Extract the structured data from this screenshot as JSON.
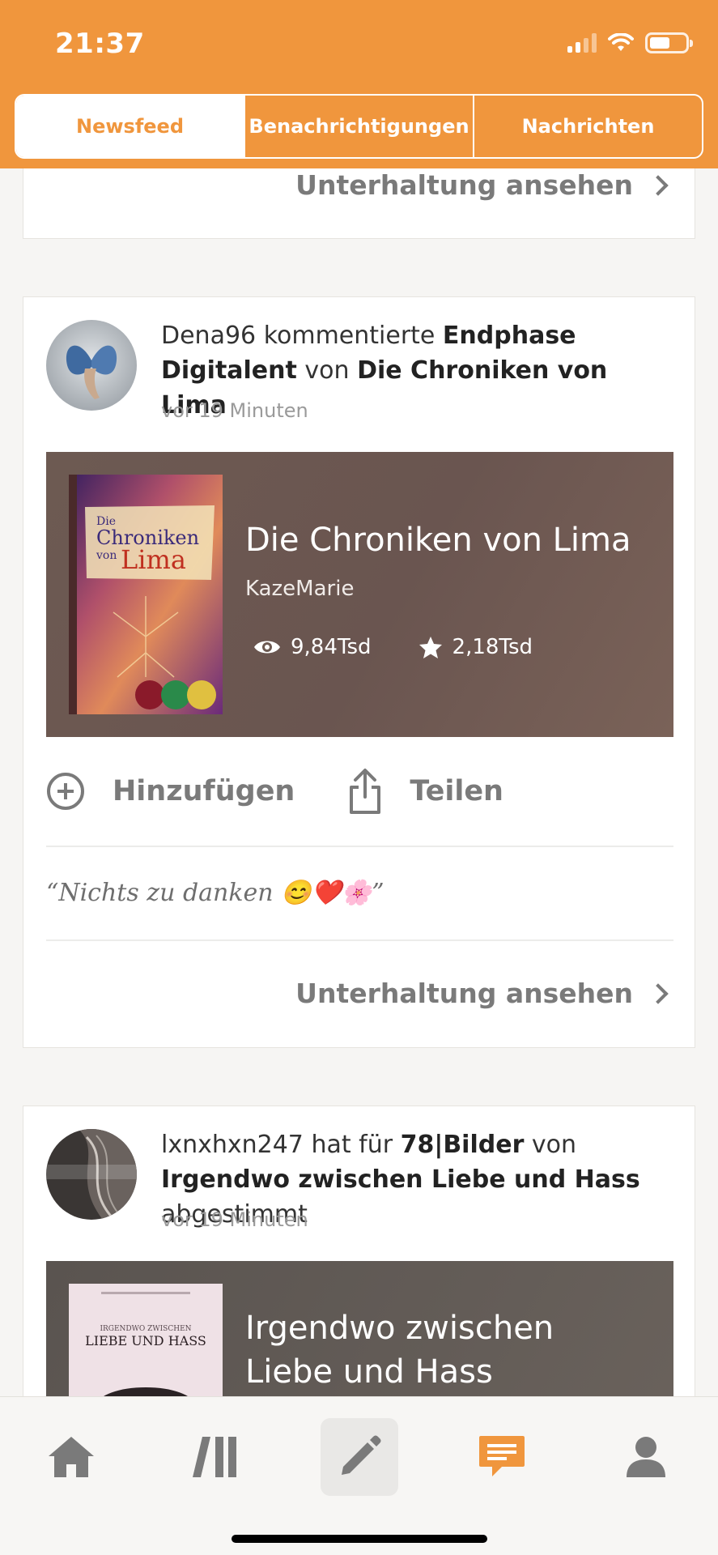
{
  "status_bar": {
    "time": "21:37"
  },
  "tabs": [
    {
      "label": "Newsfeed",
      "active": true
    },
    {
      "label": "Benachrichtigungen",
      "active": false
    },
    {
      "label": "Nachrichten",
      "active": false
    }
  ],
  "prev_card": {
    "link": "Unterhaltung ansehen"
  },
  "card1": {
    "user": "Dena96",
    "verb": "kommentierte",
    "target": "Endphase Digitalent",
    "von": "von",
    "story_ref": "Die Chroniken von Lima",
    "time": "vor 19 Minuten",
    "story": {
      "title": "Die Chroniken von Lima",
      "author": "KazeMarie",
      "views": "9,84Tsd",
      "votes": "2,18Tsd",
      "cover_text": [
        "Die",
        "Chroniken",
        "von",
        "Lima"
      ]
    },
    "add_label": "Hinzufügen",
    "share_label": "Teilen",
    "quote": "“Nichts zu danken 😊❤️🌸”",
    "link": "Unterhaltung ansehen"
  },
  "card2": {
    "user": "lxnxhxn247",
    "verb": "hat für",
    "target": "78|Bilder",
    "von": "von",
    "story_ref": "Irgendwo zwischen Liebe und Hass",
    "action": "abgestimmt",
    "time": "vor 19 Minuten",
    "story": {
      "title": "Irgendwo zwischen Liebe und Hass",
      "cover_text": [
        "IRGENDWO ZWISCHEN",
        "LIEBE UND HASS"
      ]
    }
  },
  "bottom_nav": [
    "home-icon",
    "library-icon",
    "write-icon",
    "messages-icon",
    "profile-icon"
  ],
  "colors": {
    "accent": "#f0963d",
    "text_grey": "#7a7a7a"
  }
}
